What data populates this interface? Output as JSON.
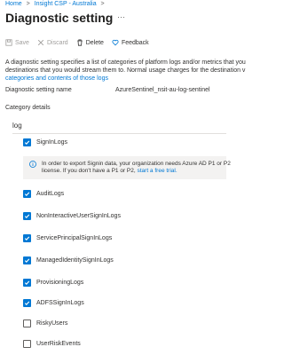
{
  "breadcrumb": {
    "home": "Home",
    "separator": ">",
    "tenant": "Insight CSP - Australia"
  },
  "page": {
    "title": "Diagnostic setting",
    "more": "···"
  },
  "toolbar": {
    "save": "Save",
    "discard": "Discard",
    "delete": "Delete",
    "feedback": "Feedback"
  },
  "description": {
    "line1": "A diagnostic setting specifies a list of categories of platform logs and/or metrics that you",
    "line2": "destinations that you would stream them to. Normal usage charges for the destination v",
    "link": "categories and contents of those logs"
  },
  "setting": {
    "name_label": "Diagnostic setting name",
    "name_value": "AzureSentinel_nsit-au-log-sentinel"
  },
  "category_details": "Category details",
  "log_header": "log",
  "info_banner": {
    "line1": "In order to export Signin data, your organization needs Azure AD P1 or P2",
    "line2": "license. If you don't have a P1 or P2,",
    "link": "start a free trial."
  },
  "logs": [
    {
      "label": "SignInLogs",
      "checked": true
    },
    {
      "label": "AuditLogs",
      "checked": true
    },
    {
      "label": "NonInteractiveUserSignInLogs",
      "checked": true
    },
    {
      "label": "ServicePrincipalSignInLogs",
      "checked": true
    },
    {
      "label": "ManagedIdentitySignInLogs",
      "checked": true
    },
    {
      "label": "ProvisioningLogs",
      "checked": true
    },
    {
      "label": "ADFSSignInLogs",
      "checked": true
    },
    {
      "label": "RiskyUsers",
      "checked": false
    },
    {
      "label": "UserRiskEvents",
      "checked": false
    }
  ],
  "colors": {
    "accent": "#0078d4",
    "text": "#323130",
    "disabled": "#a19f9d",
    "banner": "#f3f2f1"
  }
}
